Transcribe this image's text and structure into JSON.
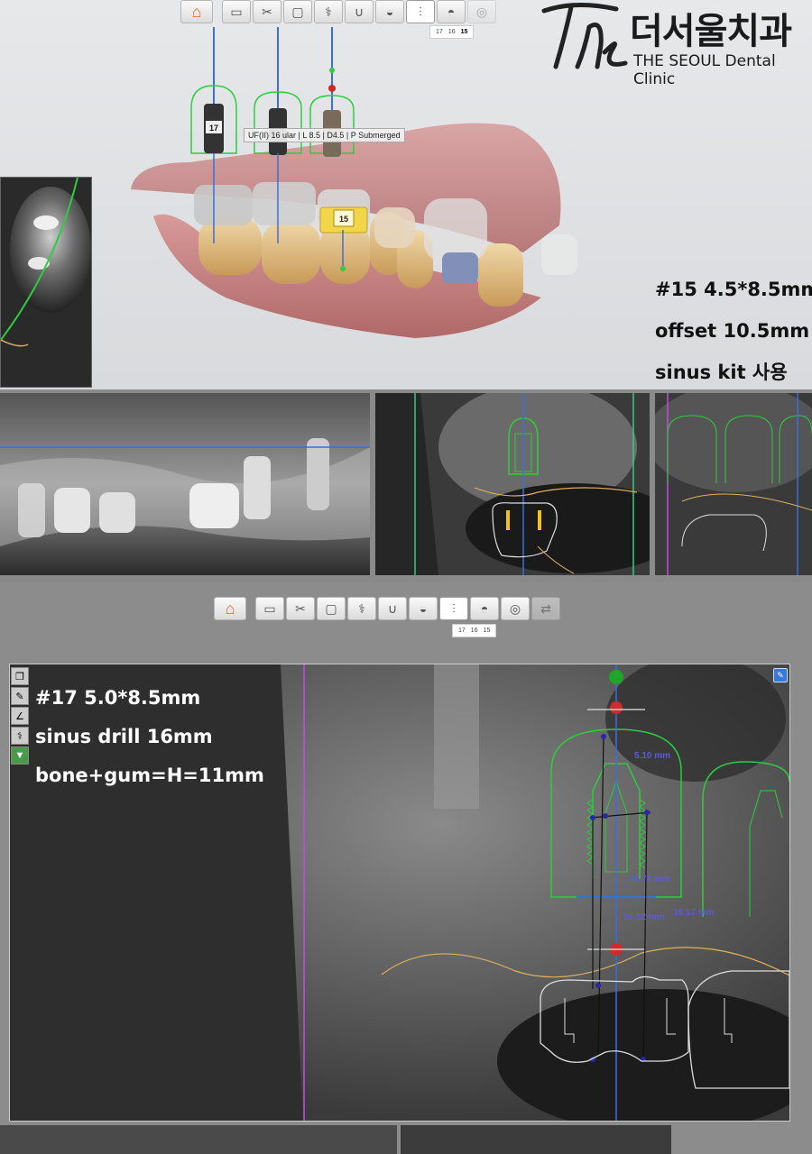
{
  "toolbar_top": {
    "steps": [
      "home-icon",
      "scan-icon",
      "cut-icon",
      "tray-icon",
      "tooth-icon",
      "arch-icon",
      "crown-icon",
      "implant-icon",
      "abutment-icon",
      "guide-icon"
    ],
    "tooth_tabs": [
      "17",
      "16",
      "15"
    ],
    "selected_tab": "15"
  },
  "toolbar_bottom": {
    "tooth_tabs": [
      "17",
      "16",
      "15"
    ],
    "selected_tab": "15"
  },
  "logo": {
    "script": "The",
    "korean": "더서울치과",
    "english": "THE SEOUL Dental Clinic"
  },
  "model": {
    "implant_labels": [
      "17",
      "15"
    ],
    "tooltip": "UF(II) 16 ular | L 8.5 | D4.5 | P Submerged"
  },
  "notes_top": {
    "line1": "#15 4.5*8.5mm",
    "line2": "offset 10.5mm",
    "line3": "sinus kit 사용"
  },
  "notes_bottom": {
    "line1": "#17 5.0*8.5mm",
    "line2": "sinus drill 16mm",
    "line3": "bone+gum=H=11mm"
  },
  "measurements": {
    "m1": "5.10 mm",
    "m2": "10.74 mm",
    "m3": "15.52 mm",
    "m4": "16.17 mm"
  },
  "colors": {
    "implant_outline": "#2ecc40",
    "axis": "#3a6fd8",
    "nerve_line": "#e0b060",
    "tooth_outline": "#e6e6e6",
    "measure": "#5b5bd8"
  }
}
